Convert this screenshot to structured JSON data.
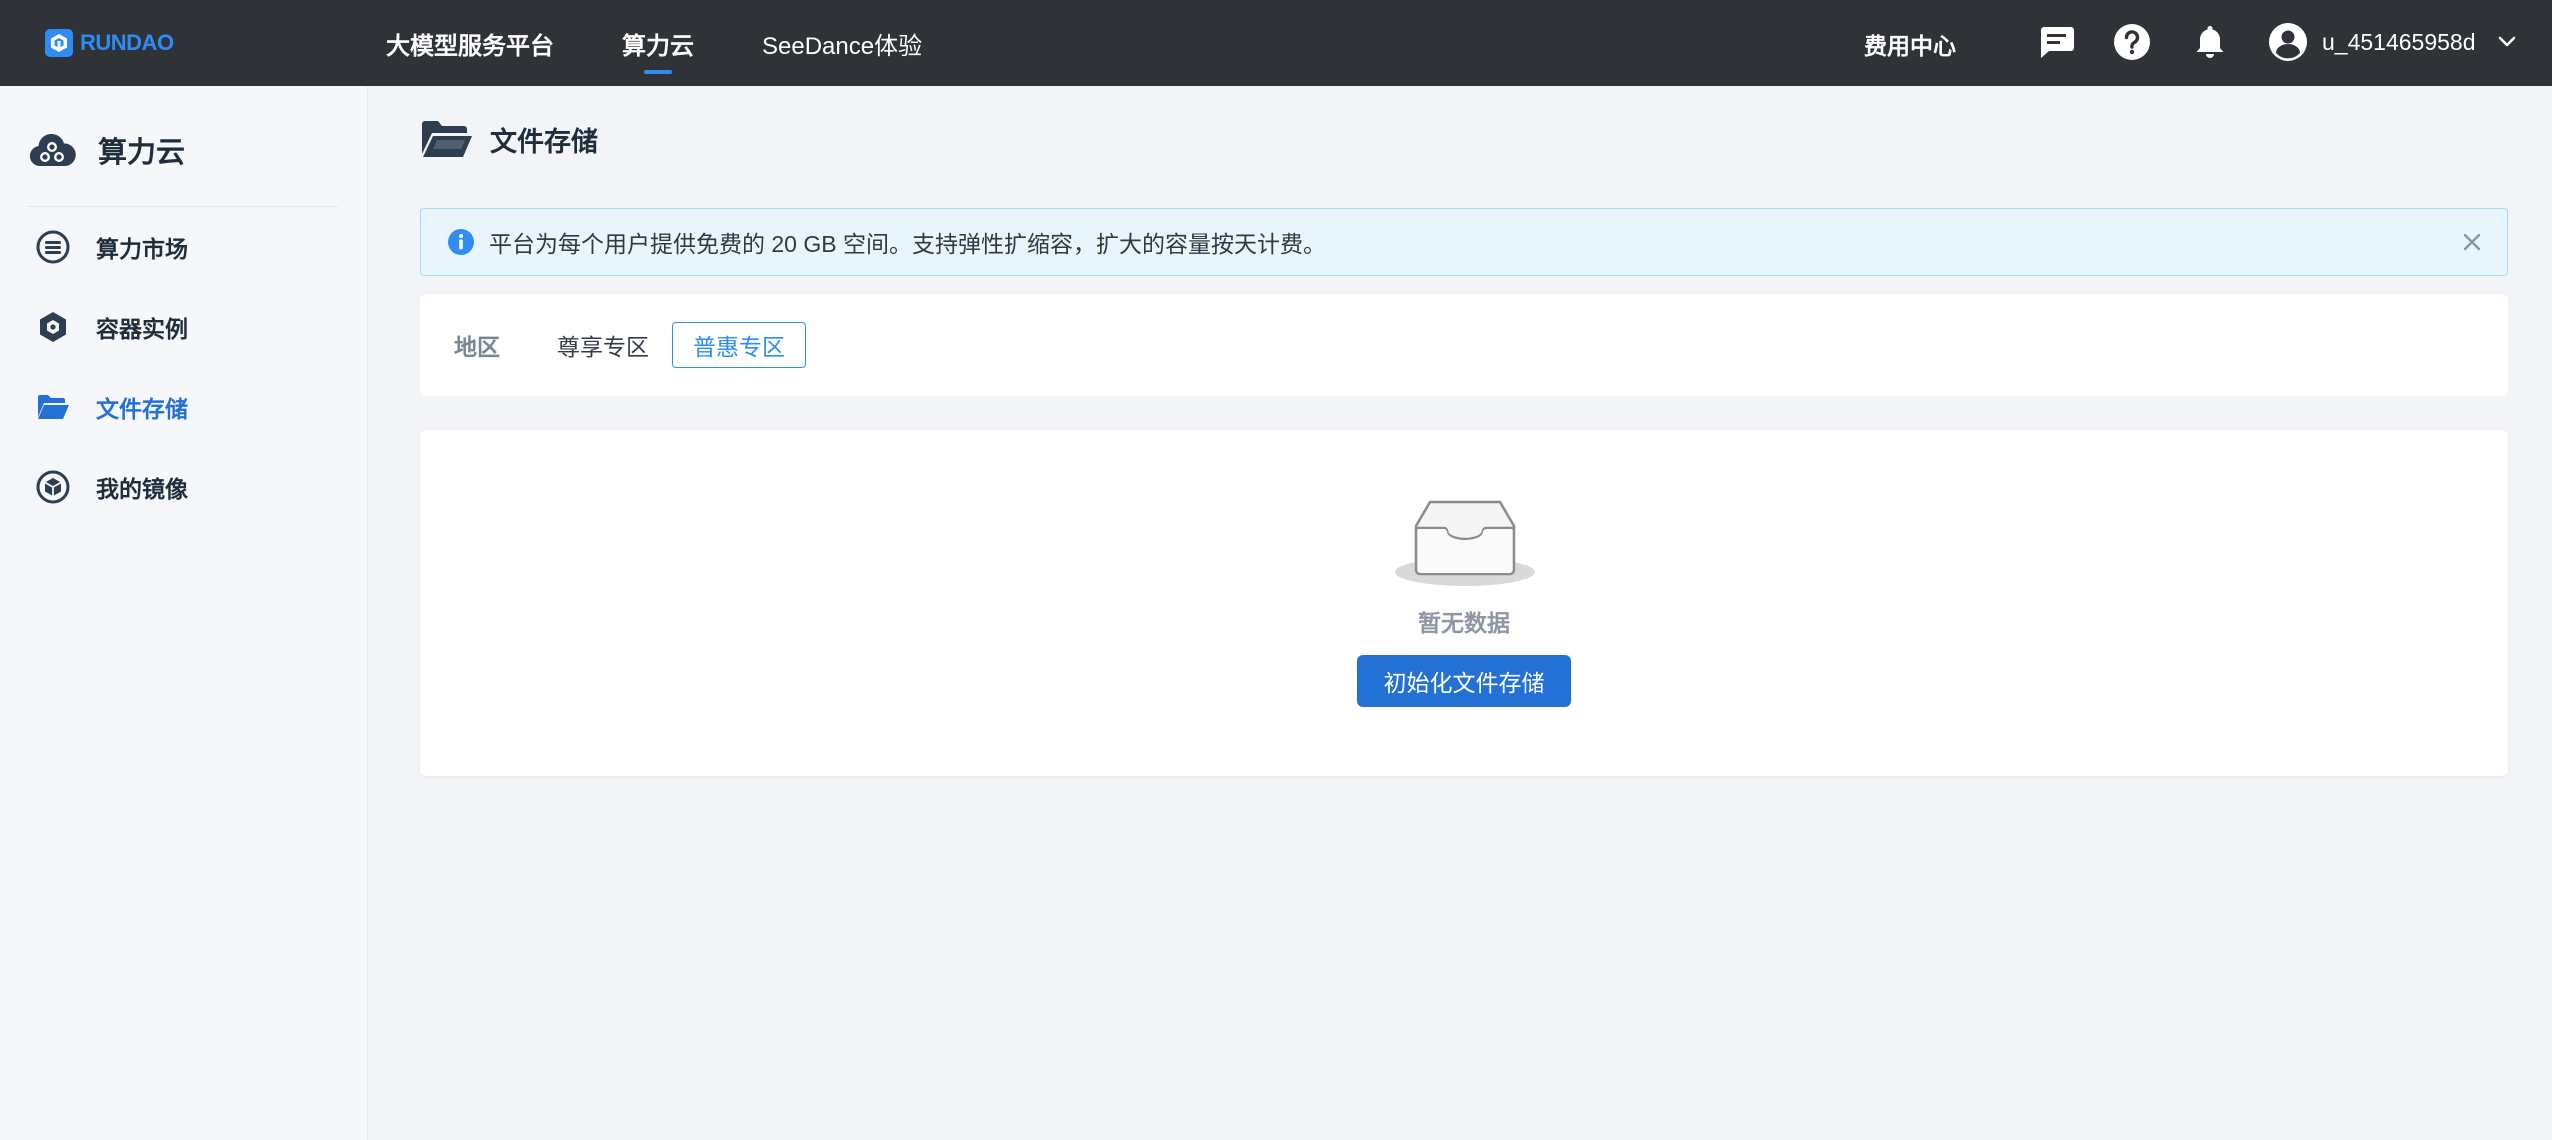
{
  "brand": {
    "name": "RUNDAO",
    "color": "#2f8cf5"
  },
  "nav": {
    "items": [
      {
        "label": "大模型服务平台",
        "active": false
      },
      {
        "label": "算力云",
        "active": true
      },
      {
        "label": "SeeDance体验",
        "active": false
      }
    ],
    "fee_center": "费用中心",
    "icons": [
      "message-icon",
      "help-icon",
      "bell-icon",
      "user-avatar-icon",
      "chevron-down-icon"
    ],
    "username": "u_451465958d"
  },
  "sidebar": {
    "title": "算力云",
    "items": [
      {
        "label": "算力市场",
        "icon": "market-icon",
        "active": false
      },
      {
        "label": "容器实例",
        "icon": "container-icon",
        "active": false
      },
      {
        "label": "文件存储",
        "icon": "folder-icon",
        "active": true
      },
      {
        "label": "我的镜像",
        "icon": "image-box-icon",
        "active": false
      }
    ]
  },
  "page": {
    "title": "文件存储",
    "notice": "平台为每个用户提供免费的 20 GB 空间。支持弹性扩缩容，扩大的容量按天计费。",
    "region_label": "地区",
    "zones": [
      {
        "label": "尊享专区",
        "active": false
      },
      {
        "label": "普惠专区",
        "active": true
      }
    ],
    "empty_text": "暂无数据",
    "init_button": "初始化文件存储"
  },
  "colors": {
    "topbar": "#2f3237",
    "accent": "#2f8cf5",
    "primary_button": "#2471d6",
    "notice_bg": "#e8f5fc",
    "notice_border": "#a6d9f2"
  }
}
